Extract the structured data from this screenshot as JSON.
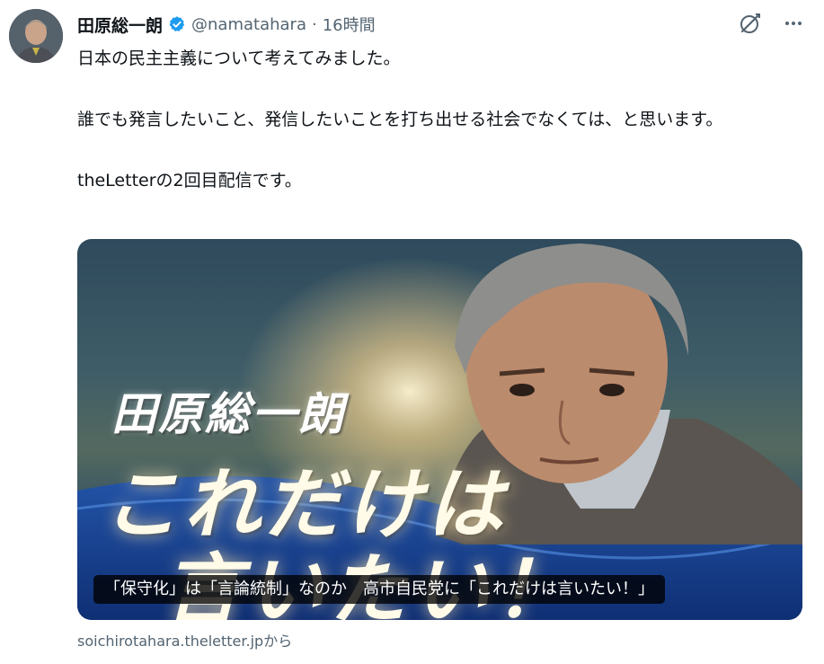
{
  "tweet": {
    "author_name": "田原総一朗",
    "handle": "@namatahara",
    "separator": "·",
    "time": "16時間",
    "paragraphs": [
      "日本の民主主義について考えてみました。",
      "誰でも発言したいこと、発信したいことを打ち出せる社会でなくては、と思います。",
      "theLetterの2回目配信です。"
    ]
  },
  "card": {
    "headline_name": "田原総一朗",
    "headline_main": "これだけは",
    "headline_sub": "言いたい！",
    "caption": "「保守化」は「言論統制」なのか　高市自民党に「これだけは言いたい！」",
    "source": "soichirotahara.theletter.jpから"
  },
  "icons": {
    "verified": "verified-badge-icon",
    "grok": "grok-icon",
    "more": "more-icon"
  },
  "colors": {
    "verified_blue": "#1d9bf0",
    "muted_text": "#536471",
    "primary_text": "#0f1419"
  }
}
